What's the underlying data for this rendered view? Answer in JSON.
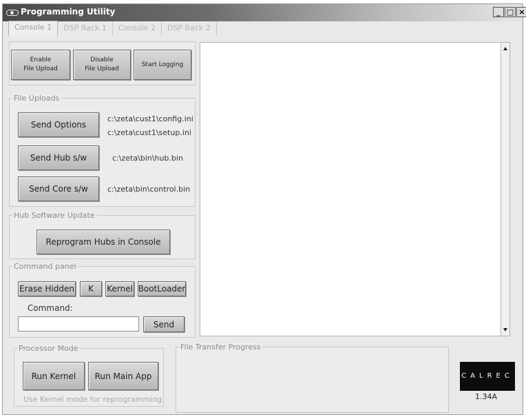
{
  "window": {
    "title": "Programming Utility",
    "min_label": "_",
    "max_label": "□",
    "close_label": "×"
  },
  "tabs": [
    {
      "label": "Console 1"
    },
    {
      "label": "DSP Rack 1"
    },
    {
      "label": "Console 2"
    },
    {
      "label": "DSP Rack 2"
    }
  ],
  "toolbar": {
    "enable_line1": "Enable",
    "enable_line2": "File Upload",
    "disable_line1": "Disable",
    "disable_line2": "File Upload",
    "start_logging": "Start Logging"
  },
  "file_uploads": {
    "title": "File Uploads",
    "send_options": "Send Options",
    "options_path1": "c:\\zeta\\cust1\\config.ini",
    "options_path2": "c:\\zeta\\cust1\\setup.ini",
    "send_hub": "Send Hub s/w",
    "hub_path": "c:\\zeta\\bin\\hub.bin",
    "send_core": "Send Core s/w",
    "core_path": "c:\\zeta\\bin\\control.bin"
  },
  "hub_update": {
    "title": "Hub Software Update",
    "reprogram": "Reprogram Hubs in Console"
  },
  "command_panel": {
    "title": "Command panel",
    "erase_hidden": "Erase Hidden",
    "k": "K",
    "kernel": "Kernel",
    "bootloader": "BootLoader",
    "command_label": "Command:",
    "command_value": "",
    "send": "Send"
  },
  "processor_mode": {
    "title": "Processor Mode",
    "run_kernel": "Run Kernel",
    "run_main": "Run Main App",
    "hint": "Use Kernel mode for reprogramming"
  },
  "transfer": {
    "title": "File Transfer Progress"
  },
  "brand": {
    "logo_text": "CALREC",
    "version": "1.34A"
  }
}
